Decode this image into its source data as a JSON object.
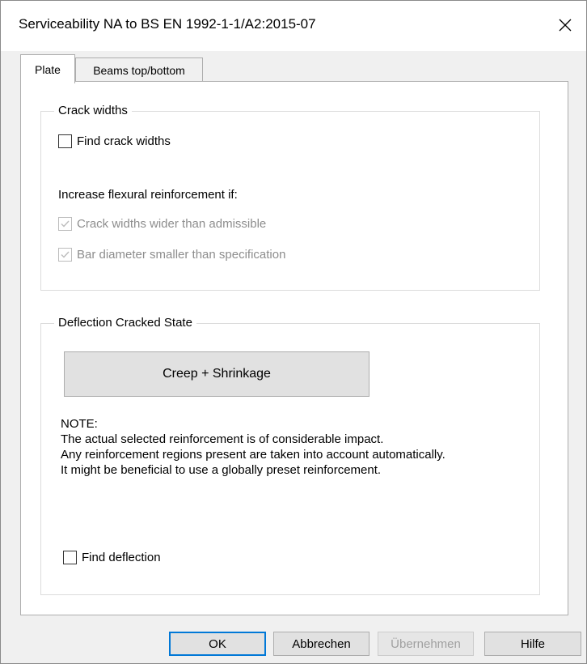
{
  "window": {
    "title": "Serviceability NA to BS EN 1992-1-1/A2:2015-07",
    "close_icon": "close-icon"
  },
  "tabs": [
    {
      "label": "Plate",
      "active": true
    },
    {
      "label": "Beams top/bottom",
      "active": false
    }
  ],
  "crack_widths": {
    "title": "Crack widths",
    "find_checkbox": {
      "label": "Find crack widths",
      "checked": false
    },
    "increase_label": "Increase flexural reinforcement if:",
    "options": [
      {
        "label": "Crack widths wider than admissible",
        "checked": true,
        "enabled": false
      },
      {
        "label": "Bar diameter smaller than specification",
        "checked": true,
        "enabled": false
      }
    ]
  },
  "deflection": {
    "title": "Deflection Cracked State",
    "creep_button": "Creep + Shrinkage",
    "note_lines": [
      "NOTE:",
      "The actual selected reinforcement is of considerable impact.",
      "Any reinforcement regions present are taken into account automatically.",
      "It might be beneficial to use a globally preset reinforcement."
    ],
    "find_checkbox": {
      "label": "Find deflection",
      "checked": false
    }
  },
  "footer": {
    "ok": "OK",
    "cancel": "Abbrechen",
    "apply": "Übernehmen",
    "help": "Hilfe"
  }
}
